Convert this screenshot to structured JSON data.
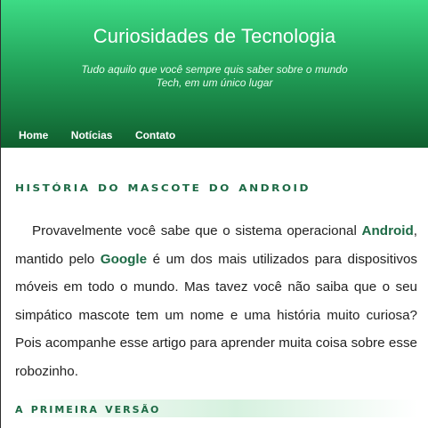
{
  "header": {
    "title": "Curiosidades de Tecnologia",
    "subtitle": "Tudo aquilo que você sempre quis saber sobre o mundo Tech, em um único lugar"
  },
  "nav": {
    "items": [
      {
        "label": "Home"
      },
      {
        "label": "Notícias"
      },
      {
        "label": "Contato"
      }
    ]
  },
  "article": {
    "title": "História do mascote do Android",
    "body": {
      "part1": "Provavelmente você sabe que o sistema operacional ",
      "android": "Android",
      "part2": ", mantido pelo ",
      "google": "Google",
      "part3": " é um dos mais utilizados para dispositivos móveis em todo o mundo. Mas tavez você não saiba que o seu simpático mascote tem um nome e uma história muito curiosa? Pois acompanhe esse artigo para aprender muita coisa sobre esse robozinho."
    },
    "section_heading": "A primeira versão"
  },
  "colors": {
    "header_top": "#3ddb85",
    "header_bottom": "#0f5f2e",
    "accent_green": "#1d6a45"
  }
}
